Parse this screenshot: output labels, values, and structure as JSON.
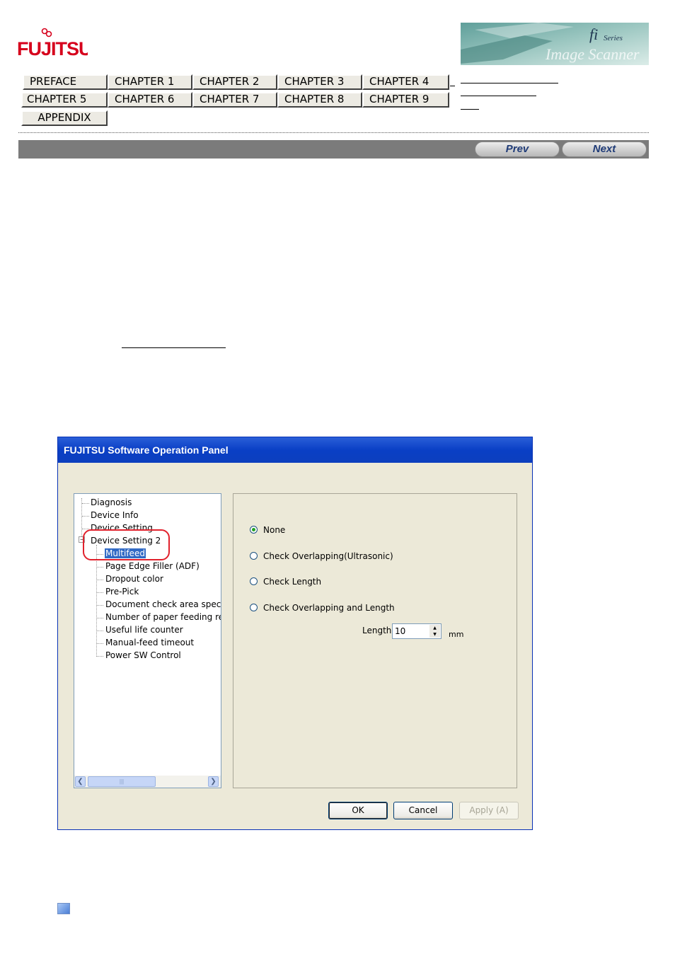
{
  "brand": {
    "logo_text": "FUJITSU",
    "series_banner_text": "fi Series",
    "series_banner_sub": "Image Scanner"
  },
  "nav": {
    "row1": [
      "PREFACE",
      "CHAPTER 1",
      "CHAPTER 2",
      "CHAPTER 3",
      "CHAPTER 4"
    ],
    "row2": [
      "CHAPTER 5",
      "CHAPTER 6",
      "CHAPTER 7",
      "CHAPTER 8",
      "CHAPTER 9"
    ],
    "row3": [
      "APPENDIX"
    ]
  },
  "pager": {
    "prev": "Prev",
    "next": "Next"
  },
  "dialog": {
    "title": "FUJITSU Software Operation Panel",
    "tree": [
      "Diagnosis",
      "Device Info",
      "Device Setting",
      "Device Setting 2",
      "Multifeed",
      "Page Edge Filler (ADF)",
      "Dropout color",
      "Pre-Pick",
      "Document check area specific",
      "Number of paper feeding retrie",
      "Useful life counter",
      "Manual-feed timeout",
      "Power SW Control"
    ],
    "selected_item": "Multifeed",
    "options": [
      "None",
      "Check Overlapping(Ultrasonic)",
      "Check Length",
      "Check Overlapping and Length"
    ],
    "selected_option": "None",
    "length": {
      "label": "Length",
      "value": "10",
      "unit": "mm"
    },
    "buttons": {
      "ok": "OK",
      "cancel": "Cancel",
      "apply": "Apply (A)"
    }
  },
  "colors": {
    "titlebar": "#0a3fc5",
    "highlight_ring": "#e1212c",
    "header_bar": "#7b7b7b",
    "selection": "#316ac5"
  }
}
